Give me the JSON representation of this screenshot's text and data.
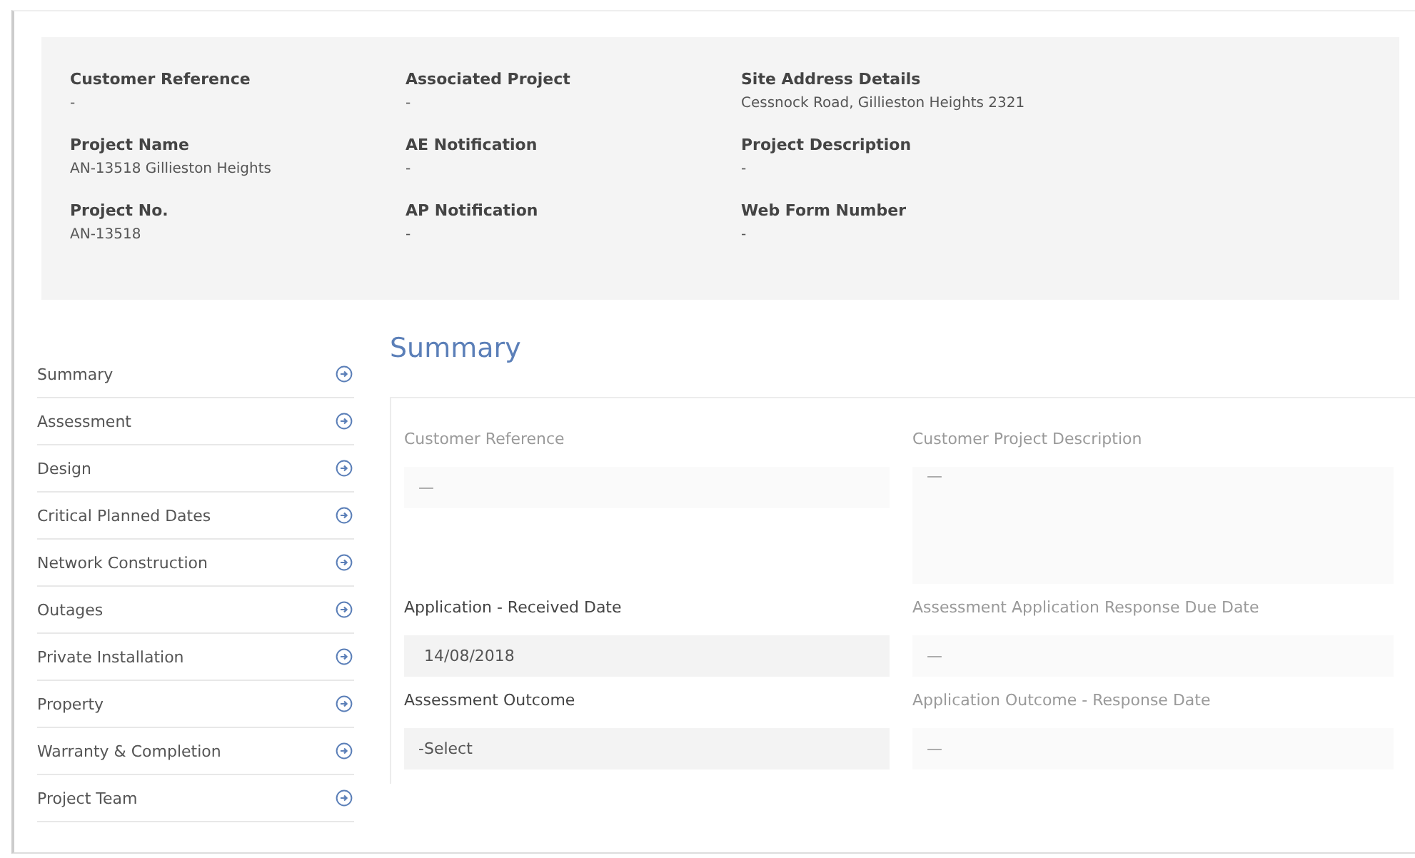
{
  "header": {
    "fields": [
      {
        "label": "Customer Reference",
        "value": "-"
      },
      {
        "label": "Associated Project",
        "value": "-"
      },
      {
        "label": "Site Address Details",
        "value": "Cessnock Road, Gillieston Heights 2321"
      },
      {
        "label": "Project Name",
        "value": "AN-13518 Gillieston Heights"
      },
      {
        "label": "AE Notification",
        "value": "-"
      },
      {
        "label": "Project Description",
        "value": "-"
      },
      {
        "label": "Project No.",
        "value": "AN-13518"
      },
      {
        "label": "AP Notification",
        "value": "-"
      },
      {
        "label": "Web Form Number",
        "value": "-"
      }
    ]
  },
  "nav": {
    "items": [
      {
        "label": "Summary"
      },
      {
        "label": "Assessment"
      },
      {
        "label": "Design"
      },
      {
        "label": "Critical Planned Dates"
      },
      {
        "label": "Network Construction"
      },
      {
        "label": "Outages"
      },
      {
        "label": "Private Installation"
      },
      {
        "label": "Property"
      },
      {
        "label": "Warranty & Completion"
      },
      {
        "label": "Project Team"
      }
    ]
  },
  "section": {
    "title": "Summary",
    "fields": [
      {
        "label": "Customer Reference",
        "value": "—",
        "disabled": true,
        "kind": "text"
      },
      {
        "label": "Customer Project Description",
        "value": "—",
        "disabled": true,
        "kind": "textarea"
      },
      {
        "label": "Application - Received Date",
        "value": "14/08/2018",
        "disabled": false,
        "kind": "text"
      },
      {
        "label": "Assessment Application Response Due Date",
        "value": "—",
        "disabled": true,
        "kind": "text"
      },
      {
        "label": "Assessment Outcome",
        "value": "-Select",
        "disabled": false,
        "kind": "select"
      },
      {
        "label": "Application Outcome - Response Date",
        "value": "—",
        "disabled": true,
        "kind": "text"
      }
    ]
  }
}
